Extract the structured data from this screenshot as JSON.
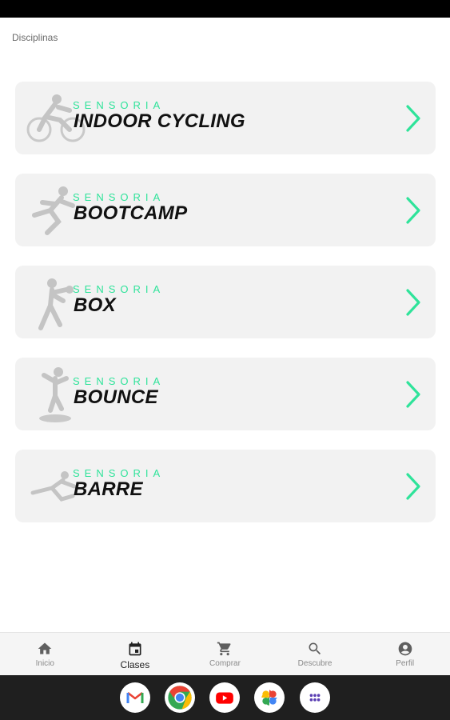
{
  "header": {
    "title": "Disciplinas"
  },
  "disciplines": [
    {
      "brand": "SENSORIA",
      "name": "INDOOR CYCLING",
      "icon": "cyclist-icon"
    },
    {
      "brand": "SENSORIA",
      "name": "BOOTCAMP",
      "icon": "runner-icon"
    },
    {
      "brand": "SENSORIA",
      "name": "BOX",
      "icon": "boxer-icon"
    },
    {
      "brand": "SENSORIA",
      "name": "BOUNCE",
      "icon": "trampoline-icon"
    },
    {
      "brand": "SENSORIA",
      "name": "BARRE",
      "icon": "ballet-icon"
    }
  ],
  "bottom_nav": {
    "active": "Clases",
    "items": [
      {
        "label": "Inicio",
        "icon": "home-icon"
      },
      {
        "label": "Clases",
        "icon": "calendar-icon"
      },
      {
        "label": "Comprar",
        "icon": "cart-icon"
      },
      {
        "label": "Descubre",
        "icon": "search-icon"
      },
      {
        "label": "Perfil",
        "icon": "account-icon"
      }
    ]
  },
  "dock": {
    "apps": [
      {
        "name": "Gmail",
        "icon": "gmail-icon"
      },
      {
        "name": "Chrome",
        "icon": "chrome-icon"
      },
      {
        "name": "YouTube",
        "icon": "youtube-icon"
      },
      {
        "name": "Google Photos",
        "icon": "photos-icon"
      },
      {
        "name": "App drawer",
        "icon": "apps-grid-icon"
      }
    ]
  },
  "colors": {
    "accent": "#2fe39a",
    "card_bg": "#f2f2f2",
    "title_text": "#111111",
    "nav_bg": "#f5f5f5",
    "system_bar": "#1f1f1f"
  }
}
